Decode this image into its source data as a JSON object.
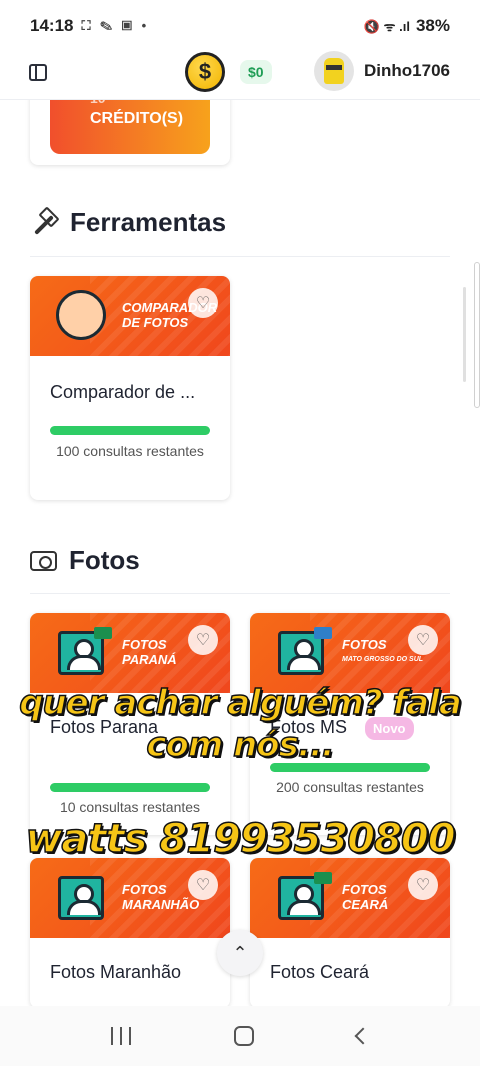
{
  "status_bar": {
    "time": "14:18",
    "notif_icons": "⛶ ✎ ▣ •",
    "right_icons": "🔇 ᯤ .ıl",
    "battery": "38%"
  },
  "header": {
    "coin_symbol": "$",
    "balance": "$0",
    "username": "Dinho1706"
  },
  "credits_card": {
    "number": "10",
    "label": "CRÉDITO(S)"
  },
  "sections": {
    "tools": {
      "title": "Ferramentas"
    },
    "photos": {
      "title": "Fotos"
    }
  },
  "tool_cards": [
    {
      "banner_title": "COMPARADOR",
      "banner_sub": "DE FOTOS",
      "title": "Comparador de ...",
      "remaining": "100 consultas restantes"
    }
  ],
  "photo_cards": [
    {
      "banner_title": "FOTOS",
      "banner_sub": "PARANÁ",
      "title": "Fotos Parana",
      "remaining": "10 consultas restantes",
      "flag_color": "#1b8f4e"
    },
    {
      "banner_title": "FOTOS",
      "banner_sub": "MATO GROSSO DO SUL",
      "title": "Fotos MS",
      "badge": "Novo",
      "remaining": "200 consultas restantes",
      "flag_color": "#2f7fc9"
    },
    {
      "banner_title": "FOTOS",
      "banner_sub": "MARANHÃO",
      "title": "Fotos Maranhão",
      "flag_color": "#d9342b"
    },
    {
      "banner_title": "FOTOS",
      "banner_sub": "CEARÁ",
      "title": "Fotos Ceará",
      "flag_color": "#1b8f4e"
    }
  ],
  "overlay_text": {
    "line1": "quer achar alguém? fala com nós...",
    "line2": "watts 81993530800"
  },
  "icons": {
    "favorite": "♡",
    "scroll_top": "⌃",
    "hammer": "hammer-icon",
    "camera": "camera-icon"
  },
  "colors": {
    "accent_orange": "#f2621a",
    "progress_green": "#2ecc65",
    "overlay_yellow": "#f6c516",
    "badge_pink": "#f5b8e4"
  }
}
